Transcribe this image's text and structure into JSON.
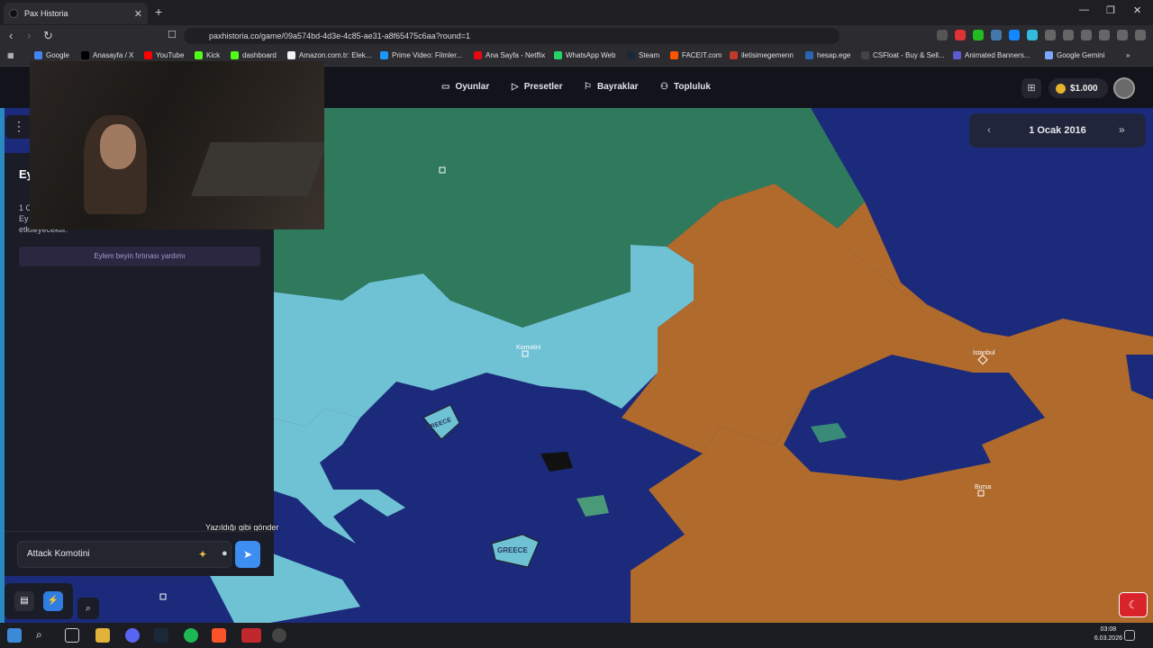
{
  "browser": {
    "tab_title": "Pax Historia",
    "new_tab_label": "+",
    "url": "paxhistoria.co/game/09a574bd-4d3e-4c85-ae31-a8f65475c6aa?round=1",
    "bookmarks": [
      {
        "label": "Google",
        "color": "#4285f4"
      },
      {
        "label": "Anasayfa / X",
        "color": "#000000"
      },
      {
        "label": "YouTube",
        "color": "#ff0000"
      },
      {
        "label": "Kick",
        "color": "#53fc18"
      },
      {
        "label": "dashboard",
        "color": "#53fc18"
      },
      {
        "label": "Amazon.com.tr: Elek...",
        "color": "#f2f2f2"
      },
      {
        "label": "Prime Video: Filmler...",
        "color": "#1a98ff"
      },
      {
        "label": "Ana Sayfa - Netflix",
        "color": "#e50914"
      },
      {
        "label": "WhatsApp Web",
        "color": "#25d366"
      },
      {
        "label": "Steam",
        "color": "#1b2838"
      },
      {
        "label": "FACEIT.com",
        "color": "#ff5500"
      },
      {
        "label": "iletisimegemenn",
        "color": "#c0392b"
      },
      {
        "label": "hesap.ege",
        "color": "#2c64b0"
      },
      {
        "label": "CSFloat - Buy & Sell...",
        "color": "#444444"
      },
      {
        "label": "Animated Banners...",
        "color": "#5b5bd6"
      },
      {
        "label": "Google Gemini",
        "color": "#7aa8ff"
      }
    ]
  },
  "nav": {
    "games": "Oyunlar",
    "presets": "Presetler",
    "flags": "Bayraklar",
    "community": "Topluluk",
    "money": "$1.000"
  },
  "date": {
    "label": "1 Ocak 2016"
  },
  "panel": {
    "heading_partial": "Ey",
    "line1_partial": "1 C",
    "line2_partial": "Ey",
    "line3": "etkileyecektir.",
    "brainstorm": "Eylem beyin fırtınası yardımı",
    "input_value": "Attack Komotini",
    "tooltip": "Yazıldığı gibi gönder"
  },
  "map": {
    "labels": {
      "komotini": "Komotini",
      "istanbul": "İstanbul",
      "bursa": "Bursa",
      "greece1": "GREECE",
      "greece2": "GREECE"
    },
    "colors": {
      "sea": "#1b2a7a",
      "greece": "#6fc2d4",
      "bulgaria": "#2f7a5c",
      "turkey": "#b06a2c"
    }
  },
  "taskbar": {
    "time": "03:08",
    "date": "6.03.2026"
  }
}
